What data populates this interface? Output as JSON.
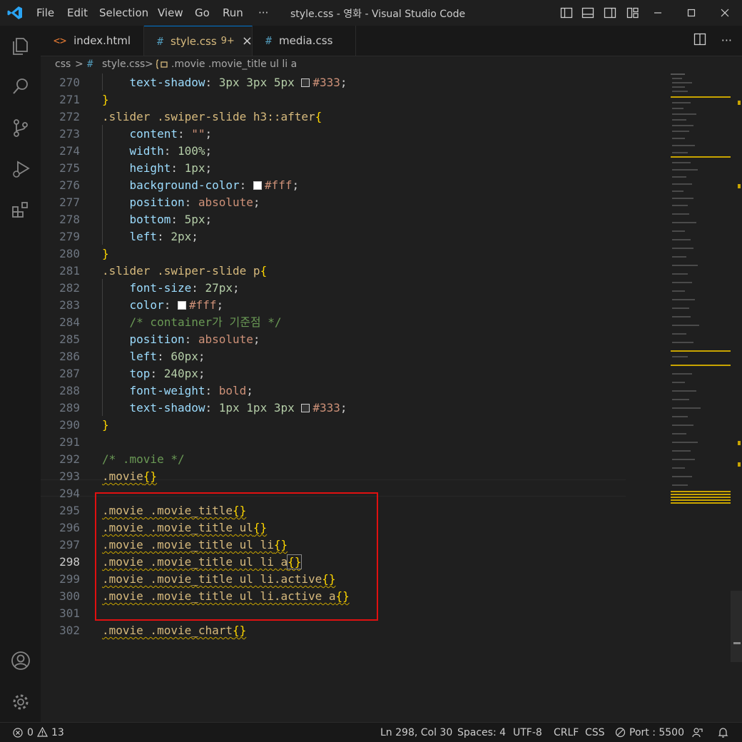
{
  "menu": {
    "file": "File",
    "edit": "Edit",
    "selection": "Selection",
    "view": "View",
    "go": "Go",
    "run": "Run",
    "more": "···"
  },
  "window_title": "style.css - 영화 - Visual Studio Code",
  "tabs": [
    {
      "icon": "<>",
      "label": "index.html",
      "badge": "",
      "color": "#e37933"
    },
    {
      "icon": "#",
      "label": "style.css",
      "badge": "9+",
      "close": "×",
      "color": "#519aba"
    },
    {
      "icon": "#",
      "label": "media.css",
      "badge": "",
      "color": "#519aba"
    }
  ],
  "breadcrumb": {
    "folder": "css",
    "sep": ">",
    "file": "style.css",
    "symbol": ".movie .movie_title ul li a"
  },
  "editor": {
    "current_line": "298",
    "lines": [
      {
        "n": "270"
      },
      {
        "n": "271"
      },
      {
        "n": "272"
      },
      {
        "n": "273"
      },
      {
        "n": "274"
      },
      {
        "n": "275"
      },
      {
        "n": "276"
      },
      {
        "n": "277"
      },
      {
        "n": "278"
      },
      {
        "n": "279"
      },
      {
        "n": "280"
      },
      {
        "n": "281"
      },
      {
        "n": "282"
      },
      {
        "n": "283"
      },
      {
        "n": "284"
      },
      {
        "n": "285"
      },
      {
        "n": "286"
      },
      {
        "n": "287"
      },
      {
        "n": "288"
      },
      {
        "n": "289"
      },
      {
        "n": "290"
      },
      {
        "n": "291"
      },
      {
        "n": "292"
      },
      {
        "n": "293"
      },
      {
        "n": "294"
      },
      {
        "n": "295"
      },
      {
        "n": "296"
      },
      {
        "n": "297"
      },
      {
        "n": "298"
      },
      {
        "n": "299"
      },
      {
        "n": "300"
      },
      {
        "n": "301"
      },
      {
        "n": "302"
      }
    ],
    "t": {
      "l270p": "text-shadow",
      "l270v": "3px 3px 5px",
      "l270c": "#333",
      "l272s": ".slider .swiper-slide h3::after",
      "l273p": "content",
      "l273v": "\"\"",
      "l274p": "width",
      "l274v": "100%",
      "l275p": "height",
      "l275v": "1px",
      "l276p": "background-color",
      "l276c": "#fff",
      "l277p": "position",
      "l277v": "absolute",
      "l278p": "bottom",
      "l278v": "5px",
      "l279p": "left",
      "l279v": "2px",
      "l281s": ".slider .swiper-slide p",
      "l282p": "font-size",
      "l282v": "27px",
      "l283p": "color",
      "l283c": "#fff",
      "l284c": "/* container가 기준점 */",
      "l285p": "position",
      "l285v": "absolute",
      "l286p": "left",
      "l286v": "60px",
      "l287p": "top",
      "l287v": "240px",
      "l288p": "font-weight",
      "l288v": "bold",
      "l289p": "text-shadow",
      "l289v": "1px 1px 3px",
      "l289c": "#333",
      "l292c": "/* .movie */",
      "l293s": ".movie",
      "l295s": ".movie .movie_title",
      "l296s": ".movie .movie_title ul",
      "l297s": ".movie .movie_title ul li",
      "l298s": ".movie .movie_title ul li a",
      "l299s": ".movie .movie_title ul li.active",
      "l300s": ".movie .movie_title ul li.active a",
      "l302s": ".movie .movie_chart"
    }
  },
  "status": {
    "errors": "0",
    "warnings": "13",
    "position": "Ln 298, Col 30",
    "spaces": "Spaces: 4",
    "encoding": "UTF-8",
    "eol": "CRLF",
    "language": "CSS",
    "port": "Port : 5500"
  },
  "colors": {
    "accent": "#0078d4",
    "highlight_box": "#e01010",
    "vscode_blue": "#2aa4f4"
  }
}
